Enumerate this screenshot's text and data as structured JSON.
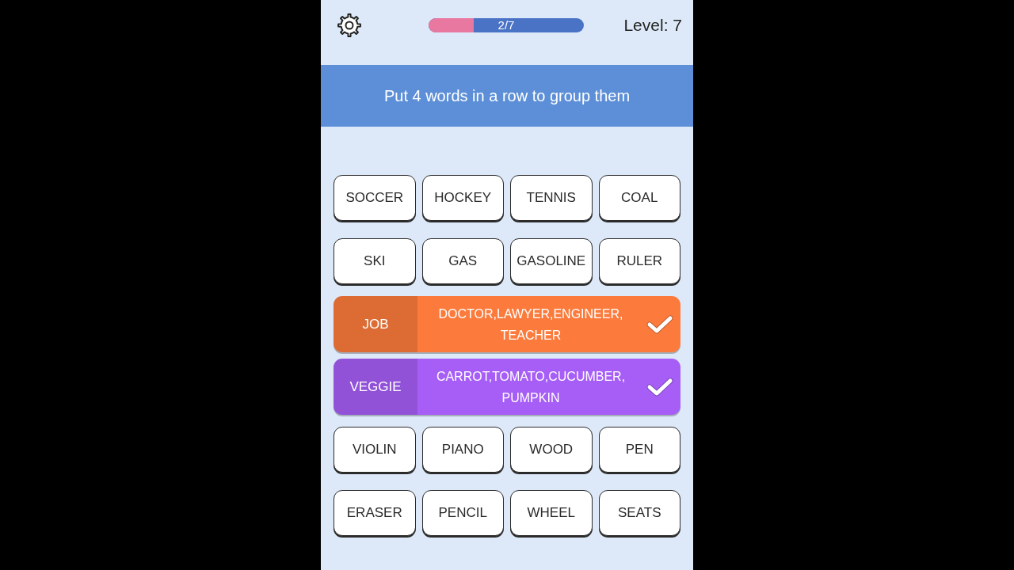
{
  "top_bar": {
    "progress": {
      "label": "2/7",
      "level": 0.29
    },
    "level_label": "Level: 7"
  },
  "banner": {
    "text": "Put 4 words in a row to group them"
  },
  "board": [
    {
      "kind": "words",
      "words": [
        "SOCCER",
        "HOCKEY",
        "TENNIS",
        "COAL"
      ]
    },
    {
      "kind": "words",
      "words": [
        "SKI",
        "GAS",
        "GASOLINE",
        "RULER"
      ]
    },
    {
      "kind": "group",
      "category": "JOB",
      "words": "DOCTOR,LAWYER,ENGINEER, TEACHER",
      "color": "#fc7b3c",
      "checked": true
    },
    {
      "kind": "group",
      "category": "VEGGIE",
      "words": "CARROT,TOMATO,CUCUMBER, PUMPKIN",
      "color": "#a65ef6",
      "checked": true
    },
    {
      "kind": "words",
      "words": [
        "VIOLIN",
        "PIANO",
        "WOOD",
        "PEN"
      ]
    },
    {
      "kind": "words",
      "words": [
        "ERASER",
        "PENCIL",
        "WHEEL",
        "SEATS"
      ]
    }
  ]
}
